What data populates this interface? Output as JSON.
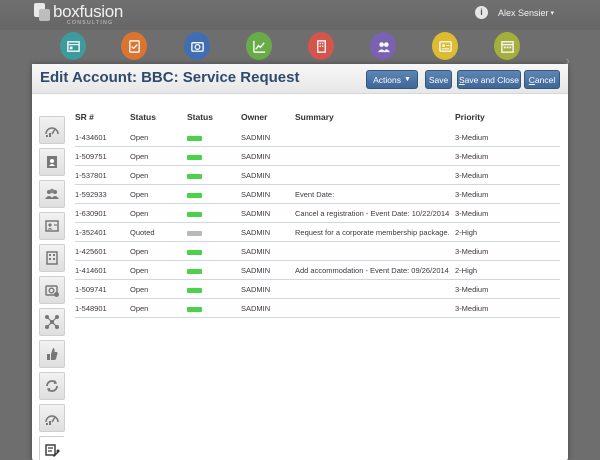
{
  "brand": {
    "name": "boxfusion",
    "sub": "CONSULTING"
  },
  "user": {
    "name": "Alex Sensier",
    "info_icon": "info-icon",
    "caret": "▾"
  },
  "apps": [
    {
      "name": "dashboard",
      "color": "#3c9ea0"
    },
    {
      "name": "tasks",
      "color": "#e0752c"
    },
    {
      "name": "camera",
      "color": "#3e6fb6"
    },
    {
      "name": "reports",
      "color": "#67b045"
    },
    {
      "name": "building",
      "color": "#d9544a"
    },
    {
      "name": "contacts",
      "color": "#7a62b5"
    },
    {
      "name": "card",
      "color": "#e6c12c"
    },
    {
      "name": "calendar",
      "color": "#a8b33a"
    }
  ],
  "page_title": "Edit Account: BBC: Service Request",
  "buttons": {
    "actions": "Actions",
    "save": "Save",
    "save_close_first": "S",
    "save_close_rest": "ave and Close",
    "cancel_first": "C",
    "cancel_rest": "ancel"
  },
  "columns": [
    "SR #",
    "Status",
    "Status",
    "Owner",
    "Summary",
    "Priority"
  ],
  "colors": {
    "open": "#4cd14a",
    "quoted": "#b9b9b9",
    "accent": "#3f6697"
  },
  "rows": [
    {
      "sr": "1-434601",
      "status": "Open",
      "owner": "SADMIN",
      "summary": "",
      "priority": "3-Medium"
    },
    {
      "sr": "1-509751",
      "status": "Open",
      "owner": "SADMIN",
      "summary": "",
      "priority": "3-Medium"
    },
    {
      "sr": "1-537801",
      "status": "Open",
      "owner": "SADMIN",
      "summary": "",
      "priority": "3-Medium"
    },
    {
      "sr": "1-592933",
      "status": "Open",
      "owner": "SADMIN",
      "summary": "Event Date:",
      "priority": "3-Medium"
    },
    {
      "sr": "1-630901",
      "status": "Open",
      "owner": "SADMIN",
      "summary": "Cancel a registration - Event Date: 10/22/2014",
      "priority": "3-Medium"
    },
    {
      "sr": "1-352401",
      "status": "Quoted",
      "owner": "SADMIN",
      "summary": "Request for a corporate membership package.",
      "priority": "2-High"
    },
    {
      "sr": "1-425601",
      "status": "Open",
      "owner": "SADMIN",
      "summary": "",
      "priority": "3-Medium"
    },
    {
      "sr": "1-414601",
      "status": "Open",
      "owner": "SADMIN",
      "summary": "Add accommodation - Event Date: 09/26/2014",
      "priority": "2-High"
    },
    {
      "sr": "1-509741",
      "status": "Open",
      "owner": "SADMIN",
      "summary": "",
      "priority": "3-Medium"
    },
    {
      "sr": "1-548901",
      "status": "Open",
      "owner": "SADMIN",
      "summary": "",
      "priority": "3-Medium"
    }
  ],
  "side_tabs": [
    "meter",
    "contact-card",
    "people",
    "id-card",
    "building",
    "camera",
    "network",
    "thumbs-up",
    "sync",
    "meter",
    "tools"
  ],
  "active_tab": 10
}
